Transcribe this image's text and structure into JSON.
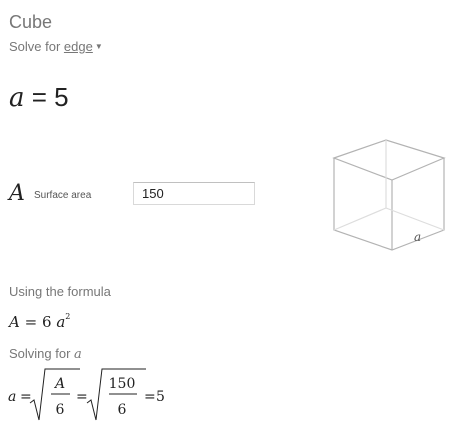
{
  "header": {
    "title": "Cube",
    "solve_for_prefix": "Solve for ",
    "solve_for_value": "edge"
  },
  "result": {
    "variable": "a",
    "equals": "=",
    "value": "5"
  },
  "input": {
    "variable": "A",
    "label": "Surface area",
    "value": "150"
  },
  "diagram": {
    "edge_label": "a"
  },
  "explanation": {
    "using_label": "Using the formula",
    "formula_lhs": "A",
    "formula_eq": "=",
    "formula_coef": "6",
    "formula_var": "a",
    "formula_exp": "2",
    "solving_label": "Solving for ",
    "solving_var": "a",
    "solution": {
      "lhs": "a",
      "eq": "=",
      "frac1_num": "A",
      "frac1_den": "6",
      "frac2_num": "150",
      "frac2_den": "6",
      "result": "5"
    }
  },
  "colors": {
    "muted_text": "#777777",
    "diagram_stroke": "#b3b3b3",
    "input_border": "#d9d9d9"
  }
}
